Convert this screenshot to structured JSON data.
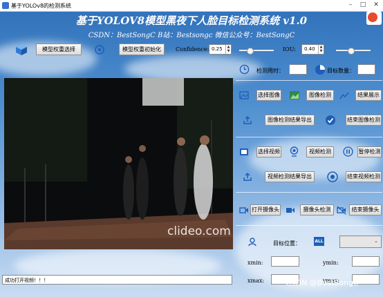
{
  "window": {
    "title": "基于YOLOv8的检测系统"
  },
  "header": {
    "title": "基于YOLOV8模型黑夜下人脸目标检测系统 v1.0",
    "subtitle": "CSDN：BestSongC   B站：Bestsongc   微信公众号：BestSongC"
  },
  "toolbar": {
    "model_select": "模型权重选择",
    "model_init": "模型权重初始化",
    "confidence_label": "Confidence:",
    "confidence_value": "0.25",
    "confidence_slider_level": 0.25,
    "iou_label": "IOU:",
    "iou_value": "0.40",
    "iou_slider_level": 0.4
  },
  "stats": {
    "time_label": "检测用时：",
    "time_value": "",
    "count_label": "目标数量：",
    "count_value": ""
  },
  "image_section": {
    "select": "选择图像",
    "detect": "图像检测",
    "show": "结果展示",
    "export": "图像检测结果导出",
    "end": "结束图像检测"
  },
  "video_section": {
    "select": "选择视频",
    "detect": "视频检测",
    "pause": "暂停检测",
    "export": "视频检测结果导出",
    "end": "结束视频检测"
  },
  "camera_section": {
    "open": "打开摄像头",
    "detect": "摄像头检测",
    "close": "结束摄像头"
  },
  "target_section": {
    "position_label": "目标位置：",
    "all_badge": "ALL",
    "combo_value": "",
    "xmin": "xmin:",
    "ymin": "ymin:",
    "xmax": "xmax:",
    "ymax": "ymax:"
  },
  "video": {
    "watermark": "clideo.com"
  },
  "status": {
    "message": "成功打开视频！！！"
  },
  "watermark": {
    "text": "CSDN @BestSongC"
  },
  "colors": {
    "accent": "#3a6fcf",
    "sky": "#4f8fd0"
  }
}
